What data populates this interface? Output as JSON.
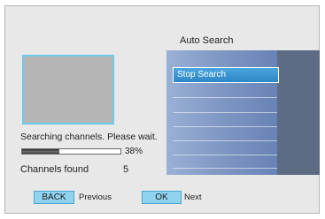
{
  "menu": {
    "title": "Auto Search",
    "selected_item": "Stop Search"
  },
  "status": {
    "message": "Searching channels. Please wait.",
    "progress_fraction": 0.38,
    "progress_text": "38%"
  },
  "channels": {
    "label": "Channels found",
    "count": "5"
  },
  "footer": {
    "back_key": "BACK",
    "back_label": "Previous",
    "ok_key": "OK",
    "ok_label": "Next"
  },
  "colors": {
    "key_fill": "#8fd3ef",
    "preview_border": "#6fc9e8",
    "menu_highlight": "#3f97d3"
  }
}
